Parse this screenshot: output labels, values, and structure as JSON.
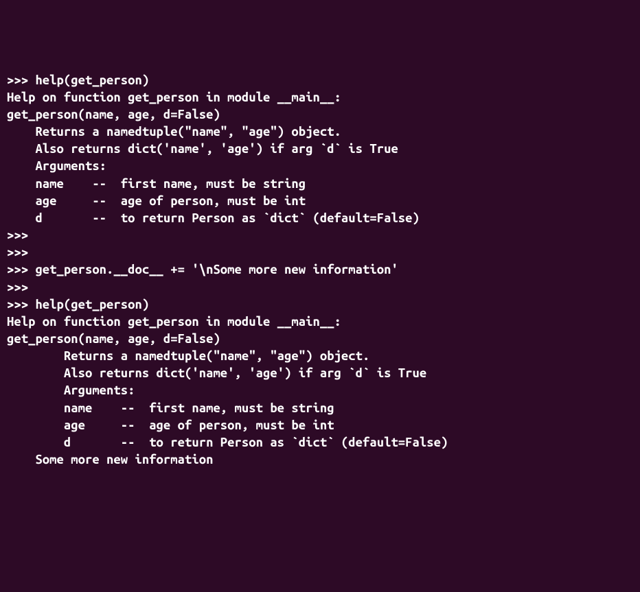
{
  "lines": [
    ">>> help(get_person)",
    "Help on function get_person in module __main__:",
    "",
    "get_person(name, age, d=False)",
    "    Returns a namedtuple(\"name\", \"age\") object.",
    "    Also returns dict('name', 'age') if arg `d` is True",
    "",
    "    Arguments:",
    "    name    --  first name, must be string",
    "    age     --  age of person, must be int",
    "    d       --  to return Person as `dict` (default=False)",
    "",
    ">>>",
    ">>>",
    ">>> get_person.__doc__ += '\\nSome more new information'",
    ">>>",
    ">>> help(get_person)",
    "Help on function get_person in module __main__:",
    "",
    "get_person(name, age, d=False)",
    "        Returns a namedtuple(\"name\", \"age\") object.",
    "        Also returns dict('name', 'age') if arg `d` is True",
    "",
    "        Arguments:",
    "        name    --  first name, must be string",
    "        age     --  age of person, must be int",
    "        d       --  to return Person as `dict` (default=False)",
    "",
    "",
    "    Some more new information"
  ]
}
